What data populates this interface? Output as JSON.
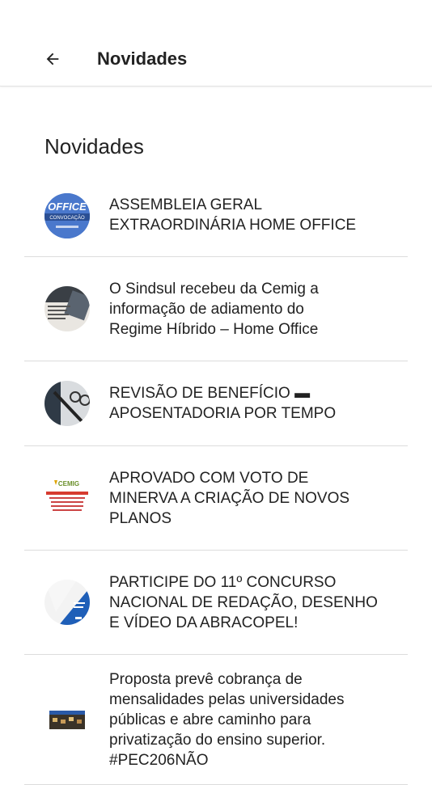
{
  "appbar": {
    "title": "Novidades",
    "back_icon": "arrow-left-icon"
  },
  "section": {
    "title": "Novidades"
  },
  "items": [
    {
      "title": "ASSEMBLEIA GERAL\nEXTRAORDINÁRIA HOME OFFICE",
      "thumb_text": "OFFICE",
      "thumb_sub": "CONVOCAÇÃO"
    },
    {
      "title": "O Sindsul recebeu da Cemig a\ninformação de adiamento do\nRegime Híbrido – Home Office"
    },
    {
      "title": "REVISÃO DE BENEFÍCIO ▬\nAPOSENTADORIA POR TEMPO"
    },
    {
      "title": "APROVADO COM VOTO DE\nMINERVA A CRIAÇÃO DE NOVOS\nPLANOS",
      "thumb_text": "CEMIG"
    },
    {
      "title": "PARTICIPE DO 11º CONCURSO\nNACIONAL DE REDAÇÃO, DESENHO\nE VÍDEO DA ABRACOPEL!"
    },
    {
      "title": "Proposta prevê cobrança de\nmensalidades pelas universidades\npúblicas e abre caminho para\nprivatização do ensino superior.\n#PEC206NÃO"
    }
  ]
}
